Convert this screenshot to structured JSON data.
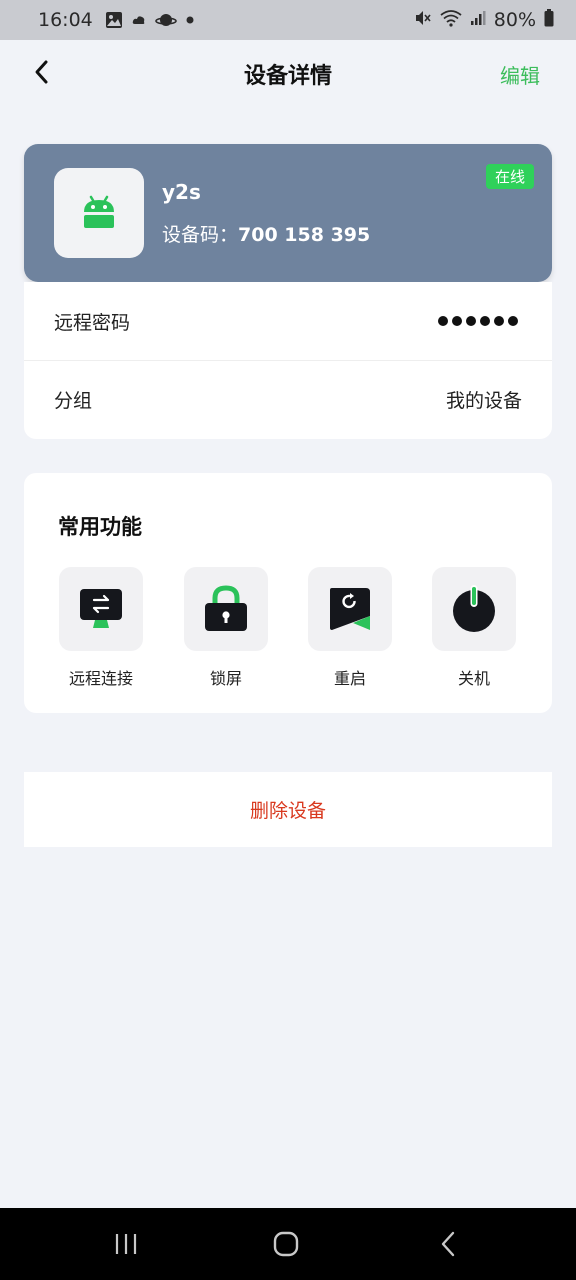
{
  "status_bar": {
    "time": "16:04",
    "battery": "80%",
    "icons": [
      "image-icon",
      "cloud-icon",
      "planet-icon",
      "dot-icon",
      "mute-icon",
      "wifi-icon",
      "signal-icon",
      "battery-icon"
    ]
  },
  "header": {
    "title": "设备详情",
    "edit_label": "编辑",
    "back_icon": "chevron-left-icon"
  },
  "device": {
    "name": "y2s",
    "code_label": "设备码：",
    "code": "700 158 395",
    "status": "在线",
    "platform_icon": "android-icon"
  },
  "info": {
    "password_label": "远程密码",
    "password_masked_count": 6,
    "group_label": "分组",
    "group_value": "我的设备"
  },
  "functions": {
    "title": "常用功能",
    "items": [
      {
        "label": "远程连接",
        "icon": "remote-connect-icon"
      },
      {
        "label": "锁屏",
        "icon": "lock-icon"
      },
      {
        "label": "重启",
        "icon": "restart-icon"
      },
      {
        "label": "关机",
        "icon": "power-icon"
      }
    ]
  },
  "delete_label": "删除设备",
  "colors": {
    "accent": "#3dbd5c",
    "card": "#6f839e",
    "online_badge": "#2fd15a",
    "danger": "#d9391f",
    "background": "#f1f3f8"
  }
}
